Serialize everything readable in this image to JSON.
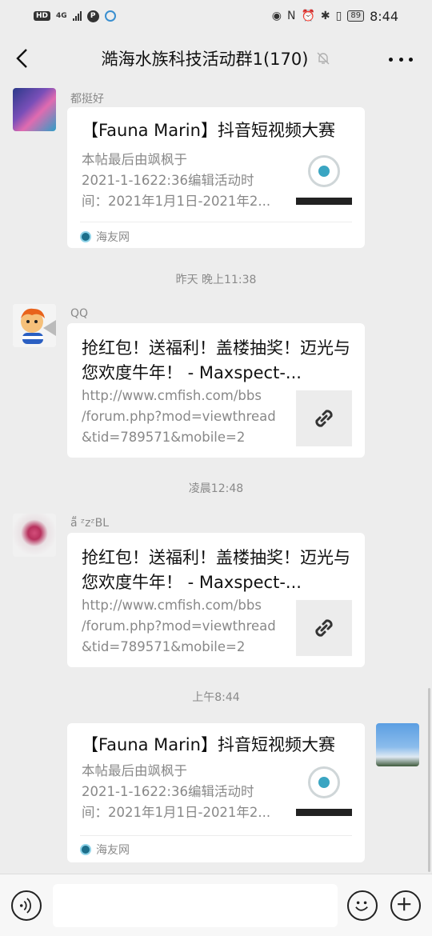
{
  "status_bar": {
    "hd": "HD",
    "network": "4G",
    "p_badge": "P",
    "battery": "89",
    "time": "8:44"
  },
  "nav": {
    "title": "澔海水族科技活动群1(170)"
  },
  "timestamps": [
    "昨天 晚上11:38",
    "凌晨12:48",
    "上午8:44"
  ],
  "messages": [
    {
      "sender": "都挺好",
      "card": {
        "title": "【Fauna Marin】抖音短视频大赛",
        "desc": "本帖最后由飒枫于\n2021-1-1622:36编辑活动时\n间：2021年1月1日-2021年2...",
        "source": "海友网"
      }
    },
    {
      "sender": "QQ",
      "card": {
        "title": "抢红包！送福利！盖楼抽奖！迈光与您欢度牛年！ - Maxspect-...",
        "desc": "http://www.cmfish.com/bbs\n/forum.php?mod=viewthread\n&tid=789571&mobile=2"
      }
    },
    {
      "sender": "ä̈̈ ᶻzᶻBL",
      "card": {
        "title": "抢红包！送福利！盖楼抽奖！迈光与您欢度牛年！ - Maxspect-...",
        "desc": "http://www.cmfish.com/bbs\n/forum.php?mod=viewthread\n&tid=789571&mobile=2"
      }
    },
    {
      "sender": "",
      "card": {
        "title": "【Fauna Marin】抖音短视频大赛",
        "desc": "本帖最后由飒枫于\n2021-1-1622:36编辑活动时\n间：2021年1月1日-2021年2...",
        "source": "海友网"
      }
    }
  ],
  "icons": {
    "back": "chevron-left-icon",
    "mute": "bell-off-icon",
    "more": "more-dots-icon",
    "link": "link-icon",
    "voice": "voice-icon",
    "emoji": "emoji-icon",
    "plus": "plus-icon"
  }
}
